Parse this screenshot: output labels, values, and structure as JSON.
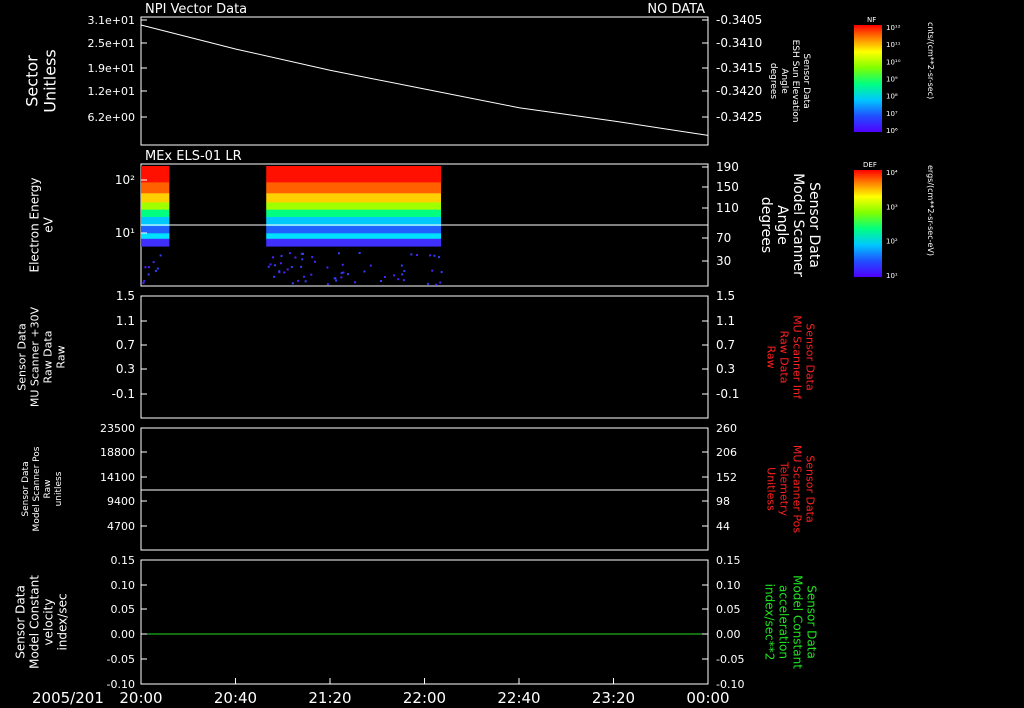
{
  "panel1": {
    "title": "NPI Vector Data",
    "status": "NO DATA",
    "left_label": [
      "Sector",
      "Unitless"
    ],
    "right_label": [
      "Sensor Data",
      "ESH Sun Elevation",
      "Angle",
      "degrees"
    ],
    "left_ticks": [
      "3.1e+01",
      "2.5e+01",
      "1.9e+01",
      "1.2e+01",
      "6.2e+00"
    ],
    "right_ticks": [
      "-0.3405",
      "-0.3410",
      "-0.3415",
      "-0.3420",
      "-0.3425"
    ]
  },
  "panel2": {
    "title": "MEx ELS-01 LR",
    "left_label": [
      "Electron Energy",
      "eV"
    ],
    "right_label": [
      "Sensor Data",
      "Model Scanner",
      "Angle",
      "degrees"
    ],
    "left_ticks": [
      "10²",
      "10¹"
    ],
    "right_ticks": [
      "190",
      "150",
      "110",
      "70",
      "30"
    ]
  },
  "panel3": {
    "left_label": [
      "Sensor Data",
      "MU Scanner +30V",
      "Raw Data",
      "Raw"
    ],
    "right_label": [
      "Sensor Data",
      "MU Scanner Inf",
      "Raw Data",
      "Raw"
    ],
    "left_ticks": [
      "1.5",
      "1.1",
      "0.7",
      "0.3",
      "-0.1"
    ],
    "right_ticks": [
      "1.5",
      "1.1",
      "0.7",
      "0.3",
      "-0.1"
    ]
  },
  "panel4": {
    "left_label": [
      "Sensor Data",
      "Model Scanner Pos",
      "Raw",
      "unitless"
    ],
    "right_label": [
      "Sensor Data",
      "MU Scanner Pos",
      "Telemetry",
      "Unitless"
    ],
    "left_ticks": [
      "23500",
      "18800",
      "14100",
      "9400",
      "4700"
    ],
    "right_ticks": [
      "260",
      "206",
      "152",
      "98",
      "44"
    ]
  },
  "panel5": {
    "left_label": [
      "Sensor Data",
      "Model Constant",
      "velocity",
      "index/sec"
    ],
    "right_label": [
      "Sensor Data",
      "Model Constant",
      "acceleration",
      "index/sec**2"
    ],
    "left_ticks": [
      "0.15",
      "0.10",
      "0.05",
      "0.00",
      "-0.05",
      "-0.10"
    ],
    "right_ticks": [
      "0.15",
      "0.10",
      "0.05",
      "0.00",
      "-0.05",
      "-0.10"
    ]
  },
  "xaxis": {
    "date": "2005/201",
    "ticks": [
      "20:00",
      "20:40",
      "21:20",
      "22:00",
      "22:40",
      "23:20",
      "00:00"
    ]
  },
  "colorbar1": {
    "title": "NF",
    "label": "cnts/(cm**2-sr-sec)",
    "ticks": [
      "10¹²",
      "10¹¹",
      "10¹⁰",
      "10⁹",
      "10⁸",
      "10⁷",
      "10⁶"
    ]
  },
  "colorbar2": {
    "title": "DEF",
    "label": "ergs/(cm**2-sr-sec-eV)",
    "ticks": [
      "10⁴",
      "10³",
      "10²",
      "10¹"
    ]
  },
  "colors": {
    "white": "#ffffff",
    "red": "#ff2020",
    "green": "#20e020"
  },
  "chart_data": [
    {
      "type": "line",
      "panel": "panel1",
      "x_range": [
        "20:00",
        "00:00"
      ],
      "x": [
        "20:00",
        "20:40",
        "21:20",
        "22:00",
        "22:40",
        "23:20",
        "00:00"
      ],
      "y": [
        -0.34045,
        -0.3409,
        -0.3413,
        -0.34165,
        -0.342,
        -0.34225,
        -0.34252
      ],
      "ylim": [
        -0.3427,
        -0.3403
      ]
    },
    {
      "type": "heatmap",
      "panel": "panel2",
      "yscale": "log",
      "data_intervals": [
        [
          "20:00",
          "20:12"
        ],
        [
          "20:53",
          "22:07"
        ]
      ],
      "reference_line_right_axis": 92
    },
    {
      "type": "line",
      "panel": "panel3",
      "series": []
    },
    {
      "type": "line",
      "panel": "panel4",
      "constant_left_axis": 12000
    },
    {
      "type": "line",
      "panel": "panel5",
      "constant": 0.0,
      "ylim": [
        -0.1,
        0.15
      ]
    }
  ]
}
